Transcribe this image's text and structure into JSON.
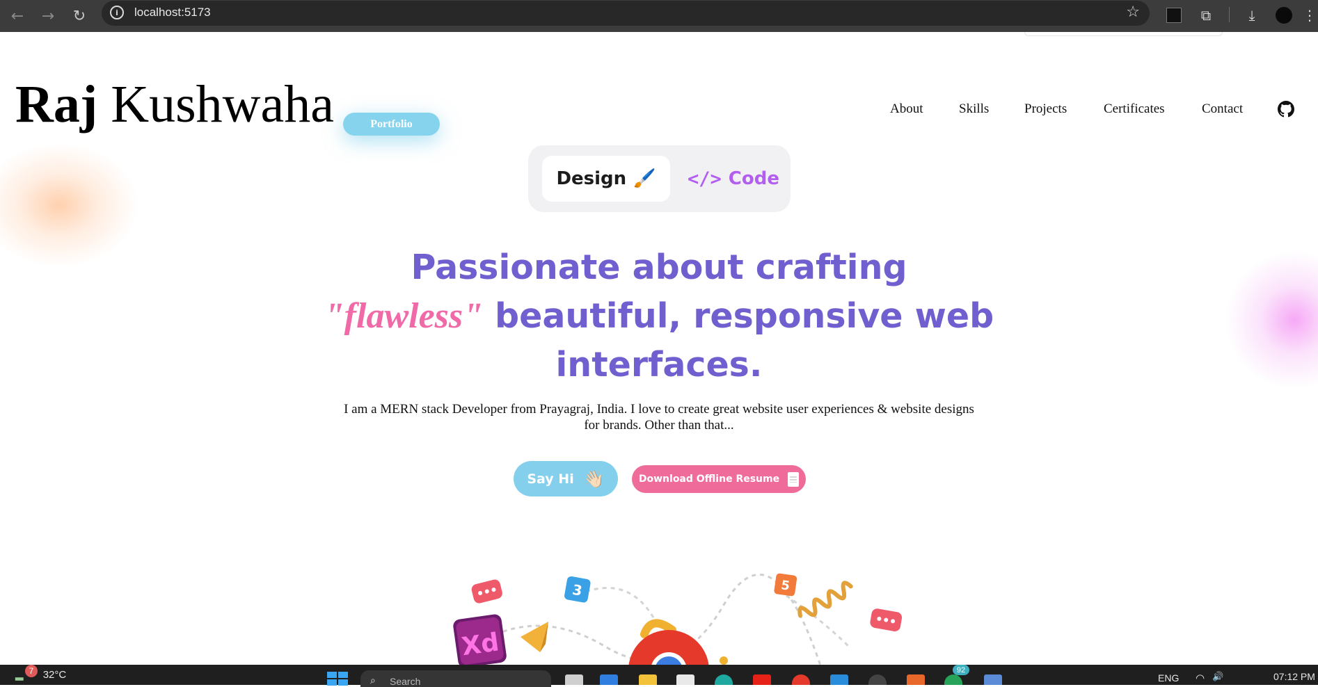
{
  "browser": {
    "url": "localhost:5173",
    "back_icon": "←",
    "forward_icon": "→",
    "reload_icon": "↻",
    "info_icon": "i",
    "star_icon": "☆",
    "extensions_icon": "⧉",
    "download_icon": "⤓",
    "menu_icon": "⋮"
  },
  "header": {
    "brand_first": "Raj",
    "brand_last": "Kushwaha",
    "badge": "Portfolio",
    "nav": [
      "About",
      "Skills",
      "Projects",
      "Certificates",
      "Contact"
    ]
  },
  "toggle": {
    "design_label": "Design",
    "design_icon": "🖌️",
    "code_label": "Code",
    "code_icon": "</>"
  },
  "hero": {
    "line1": "Passionate about crafting",
    "accent": "\"flawless\"",
    "line2": " beautiful, responsive web",
    "line3": "interfaces.",
    "intro": "I am a MERN stack Developer from Prayagraj, India. I love to create great website user experiences & website designs for brands. Other than that..."
  },
  "buttons": {
    "say_hi": "Say Hi",
    "say_hi_icon": "👋🏻",
    "resume": "Download Offline Resume"
  },
  "illustration": {
    "xd_label": "Xd",
    "html_label": "5",
    "css_label": "3"
  },
  "taskbar": {
    "weather_badge": "7",
    "temperature": "32°C",
    "search_icon": "⌕",
    "search_text": "Search",
    "app_badge": "92",
    "language": "ENG",
    "wifi_icon": "◠",
    "volume_icon": "🔊",
    "time": "07:12 PM"
  },
  "colors": {
    "headline": "#6f5fcf",
    "accent": "#f06aa8",
    "sayhi_bg": "#84d0ec",
    "resume_bg": "#ef6c9a",
    "code_purple": "#b25ff0",
    "badge_blue": "#86d3ee"
  }
}
